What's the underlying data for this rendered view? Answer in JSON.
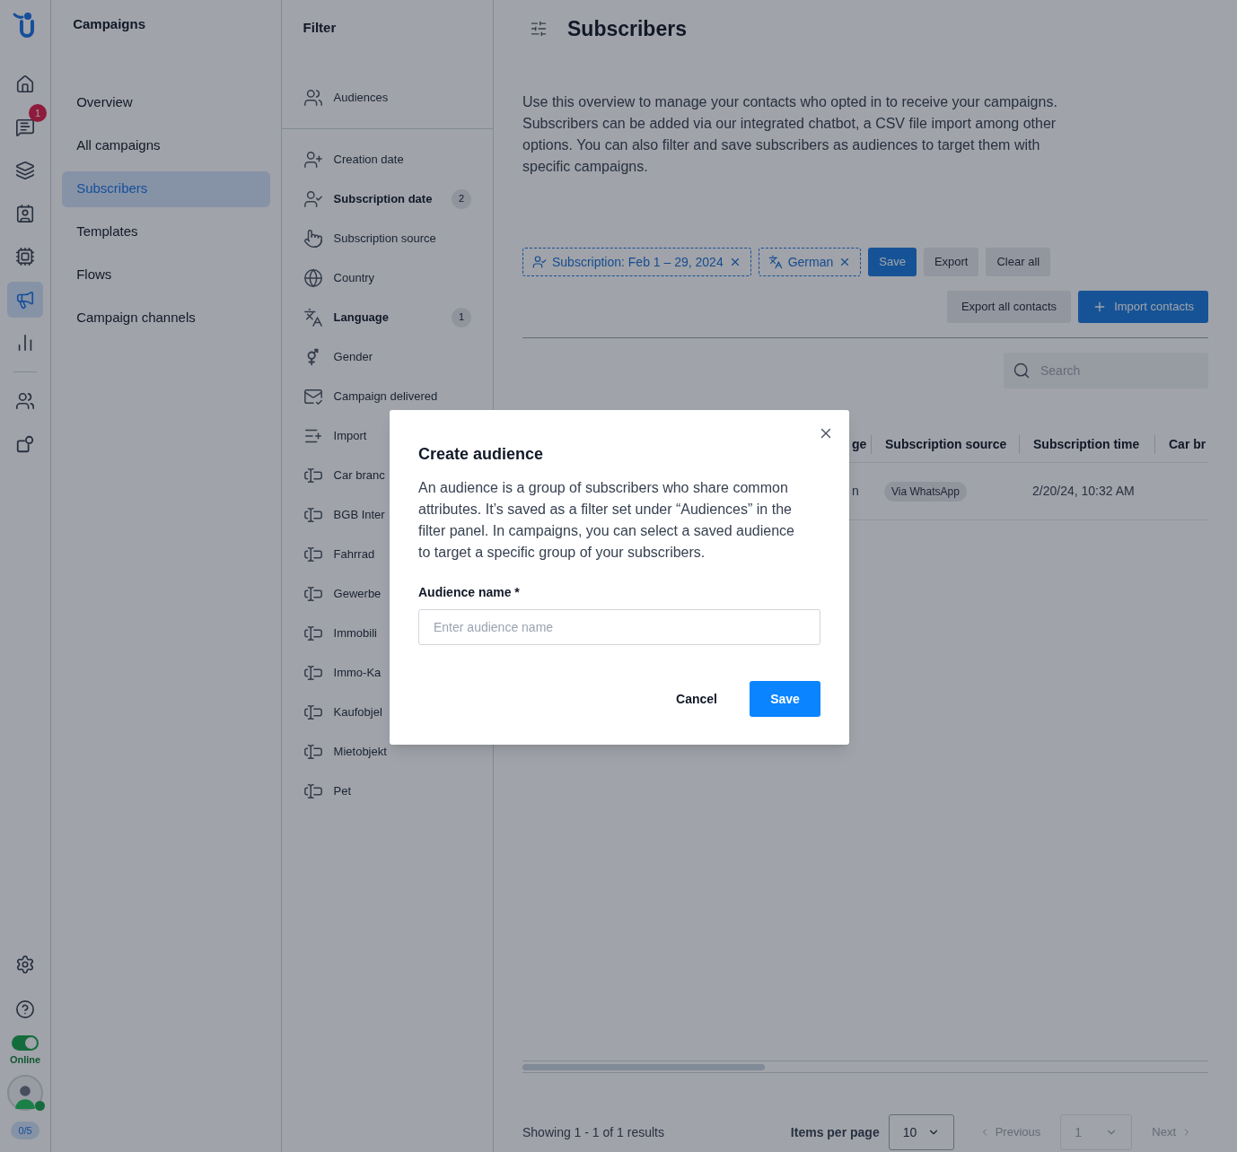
{
  "rail": {
    "items": [
      {
        "selected": false
      },
      {
        "selected": false,
        "badge": "1"
      },
      {
        "selected": false
      },
      {
        "selected": false
      },
      {
        "selected": false
      },
      {
        "selected": true
      },
      {
        "selected": false
      },
      {
        "selected": false
      },
      {
        "selected": false
      }
    ],
    "status": {
      "online": true,
      "label": "Online"
    },
    "agent_count": "0/5"
  },
  "sidebar": {
    "title": "Campaigns",
    "items": [
      {
        "label": "Overview",
        "selected": false
      },
      {
        "label": "All campaigns",
        "selected": false
      },
      {
        "label": "Subscribers",
        "selected": true
      },
      {
        "label": "Templates",
        "selected": false
      },
      {
        "label": "Flows",
        "selected": false
      },
      {
        "label": "Campaign channels",
        "selected": false
      }
    ]
  },
  "filter": {
    "title": "Filter",
    "audiences": "Audiences",
    "items": [
      {
        "label": "Creation date",
        "active": false
      },
      {
        "label": "Subscription date",
        "active": true,
        "count": "2"
      },
      {
        "label": "Subscription source",
        "active": false
      },
      {
        "label": "Country",
        "active": false
      },
      {
        "label": "Language",
        "active": true,
        "count": "1"
      },
      {
        "label": "Gender",
        "active": false
      },
      {
        "label": "Campaign delivered",
        "active": false
      },
      {
        "label": "Import",
        "active": false
      },
      {
        "label": "Car branc",
        "active": false
      },
      {
        "label": "BGB Inter",
        "active": false
      },
      {
        "label": "Fahrrad",
        "active": false
      },
      {
        "label": "Gewerbe",
        "active": false
      },
      {
        "label": "Immobili",
        "active": false
      },
      {
        "label": "Immo-Ka",
        "active": false
      },
      {
        "label": "Kaufobjel",
        "active": false
      },
      {
        "label": "Mietobjekt",
        "active": false
      },
      {
        "label": "Pet",
        "active": false
      }
    ]
  },
  "main": {
    "title": "Subscribers",
    "description": "Use this overview to manage your contacts who opted in to receive your campaigns. Subscribers can be added via our integrated chatbot, a CSV file import among other options. You can also filter and save subscribers as audiences to target them with specific campaigns.",
    "chips": [
      {
        "label": "Subscription: Feb 1 – 29, 2024"
      },
      {
        "label": "German"
      }
    ],
    "chip_buttons": {
      "save": "Save",
      "export": "Export",
      "clear": "Clear all"
    },
    "export_all": "Export all contacts",
    "import": "Import contacts",
    "search": {
      "placeholder": "Search"
    },
    "table": {
      "columns": [
        "ge",
        "Subscription source",
        "Subscription time",
        "Car br"
      ],
      "rows": [
        {
          "cells": [
            "n",
            "Via WhatsApp",
            "2/20/24, 10:32 AM"
          ]
        }
      ]
    },
    "footer": {
      "summary": "Showing 1 - 1 of 1 results",
      "items_per_page": "Items per page",
      "page_size": "10",
      "previous": "Previous",
      "page": "1",
      "next": "Next",
      "previous_disabled": true,
      "next_disabled": true
    }
  },
  "modal": {
    "title": "Create audience",
    "body": "An audience is a group of subscribers who share common attributes. It’s saved as a filter set under “Audiences” in the filter panel. In campaigns, you can select a saved audience to target a specific group of your subscribers.",
    "field_label": "Audience name *",
    "placeholder": "Enter audience name",
    "cancel": "Cancel",
    "save": "Save"
  }
}
